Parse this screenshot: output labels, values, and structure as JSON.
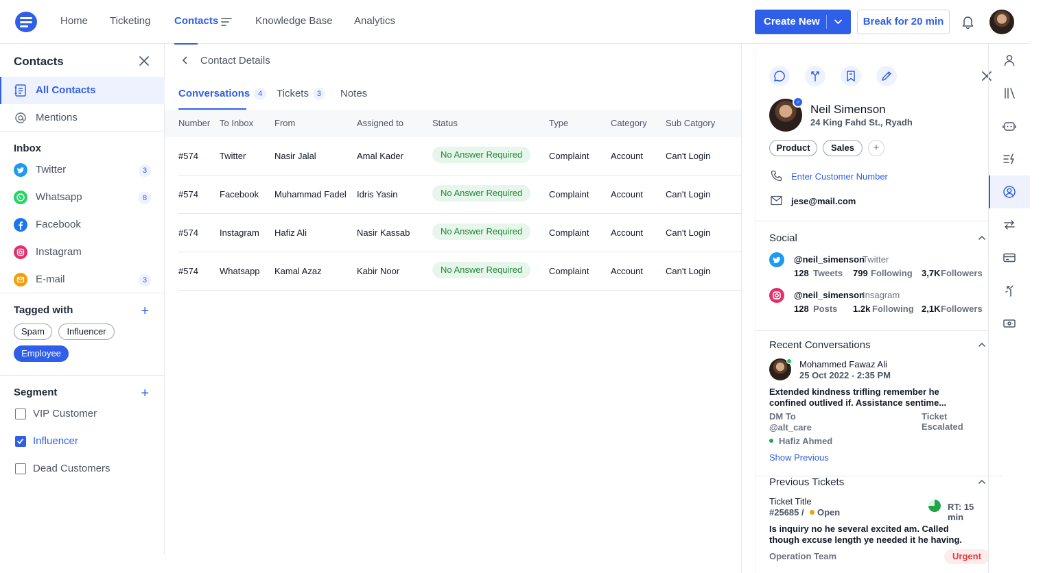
{
  "nav": {
    "items": [
      {
        "label": "Home"
      },
      {
        "label": "Ticketing"
      },
      {
        "label": "Contacts"
      },
      {
        "label": "Knowledge Base"
      },
      {
        "label": "Analytics"
      }
    ],
    "active": "Contacts",
    "create_new": "Create New",
    "break_button": "Break for 20 min"
  },
  "sidebar": {
    "title": "Contacts",
    "items": [
      {
        "label": "All Contacts",
        "icon": "contacts-list-icon"
      },
      {
        "label": "Mentions",
        "icon": "at-sign-icon"
      }
    ],
    "inbox_title": "Inbox",
    "inbox": [
      {
        "label": "Twitter",
        "count": "3",
        "color": "#1d9bf0"
      },
      {
        "label": "Whatsapp",
        "count": "8",
        "color": "#25d366"
      },
      {
        "label": "Facebook",
        "count": "",
        "color": "#1877f2"
      },
      {
        "label": "Instagram",
        "count": "",
        "color": "#e1306c"
      },
      {
        "label": "E-mail",
        "count": "3",
        "color": "#f59e0b"
      }
    ],
    "tagged_title": "Tagged with",
    "tags": [
      "Spam",
      "Influencer",
      "Employee"
    ],
    "segment_title": "Segment",
    "segments": [
      {
        "label": "VIP Customer",
        "checked": false
      },
      {
        "label": "Influencer",
        "checked": true
      },
      {
        "label": "Dead Customers",
        "checked": false
      }
    ]
  },
  "main": {
    "back_title": "Contact Details",
    "tabs": [
      {
        "label": "Conversations",
        "count": "4"
      },
      {
        "label": "Tickets",
        "count": "3"
      },
      {
        "label": "Notes",
        "count": ""
      }
    ],
    "columns": [
      "Number",
      "To Inbox",
      "From",
      "Assigned to",
      "Status",
      "Type",
      "Category",
      "Sub Catgory"
    ],
    "rows": [
      [
        "#574",
        "Twitter",
        "Nasir Jalal",
        "Amal Kader",
        "No Answer Required",
        "Complaint",
        "Account",
        "Can't Login"
      ],
      [
        "#574",
        "Facebook",
        "Muhammad Fadel",
        "Idris Yasin",
        "No Answer Required",
        "Complaint",
        "Account",
        "Can't Login"
      ],
      [
        "#574",
        "Instagram",
        "Hafiz Ali",
        "Nasir Kassab",
        "No Answer Required",
        "Complaint",
        "Account",
        "Can't Login"
      ],
      [
        "#574",
        "Whatsapp",
        "Kamal Azaz",
        "Kabir Noor",
        "No Answer Required",
        "Complaint",
        "Account",
        "Can't Login"
      ]
    ]
  },
  "contact": {
    "name": "Neil Simenson",
    "address": "24 King Fahd St., Ryadh",
    "tags": [
      "Product",
      "Sales"
    ],
    "phone_placeholder": "Enter Customer Number",
    "email": "jese@mail.com",
    "social_title": "Social",
    "twitter": {
      "handle": "@neil_simenson",
      "network": "Twitter",
      "stat1_value": "128",
      "stat1_label": "Tweets",
      "stat2_value": "799",
      "stat2_label": "Following",
      "stat3_value": "3,7K",
      "stat3_label": "Followers"
    },
    "instagram": {
      "handle": "@neil_simenson",
      "network": "Insagram",
      "stat1_value": "128",
      "stat1_label": "Posts",
      "stat2_value": "1.2k",
      "stat2_label": "Following",
      "stat3_value": "2,1K",
      "stat3_label": "Followers"
    },
    "recent_title": "Recent Conversations",
    "recent": {
      "name": "Mohammed Fawaz Ali",
      "date": "25 Oct 2022 - 2:35 PM",
      "message": "Extended kindness trifling remember he confined outlived if. Assistance sentime...",
      "dm_label": "DM To",
      "dm_handle": "@alt_care",
      "status": "Ticket Escalated",
      "agent": "Hafiz Ahmed",
      "show_previous": "Show Previous"
    },
    "prev_title": "Previous Tickets",
    "ticket": {
      "title": "Ticket Title",
      "number": "#25685 /",
      "state": "Open",
      "rt": "RT: 15 min",
      "message": "Is inquiry no he several excited am. Called though excuse length ye needed it he having.",
      "team": "Operation Team",
      "priority": "Urgent"
    }
  },
  "colors": {
    "accent": "#2f5fe8",
    "success": "#22863a",
    "danger": "#e23c3c",
    "open": "#f59e0b"
  }
}
